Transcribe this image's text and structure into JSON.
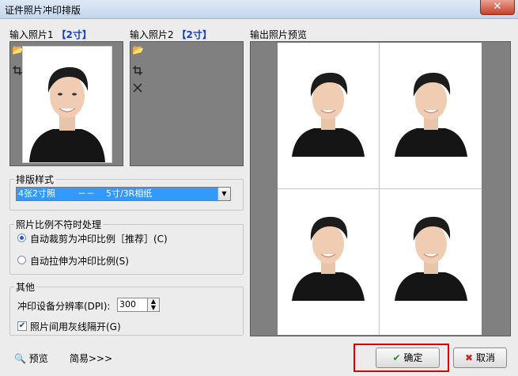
{
  "window": {
    "title": "证件照片冲印排版",
    "close_glyph": "✕"
  },
  "input1": {
    "label": "输入照片1",
    "size": "【2寸】"
  },
  "input2": {
    "label": "输入照片2",
    "size": "【2寸】"
  },
  "preview": {
    "label": "输出照片预览"
  },
  "layout_group": {
    "title": "排版样式",
    "selected": "4张2寸照        －－    5寸/3R相纸"
  },
  "ratio_group": {
    "title": "照片比例不符时处理",
    "option1": "自动裁剪为冲印比例［推荐］(C)",
    "option2": "自动拉伸为冲印比例(S)",
    "selected_index": 0
  },
  "other_group": {
    "title": "其他",
    "dpi_label": "冲印设备分辨率(DPI):",
    "dpi_value": "300",
    "gray_line_label": "照片间用灰线隔开(G)",
    "gray_line_checked": true
  },
  "footer": {
    "preview_link": "预览",
    "simple_link": "简易>>>",
    "ok_button": "确定",
    "cancel_button": "取消"
  },
  "colors": {
    "selection": "#3399ff",
    "highlight": "#e00000",
    "size_tag": "#1a3fbf"
  },
  "icons": [
    "folder-icon",
    "crop-icon",
    "delete-icon",
    "search-icon",
    "check-icon",
    "cancel-x-icon"
  ]
}
